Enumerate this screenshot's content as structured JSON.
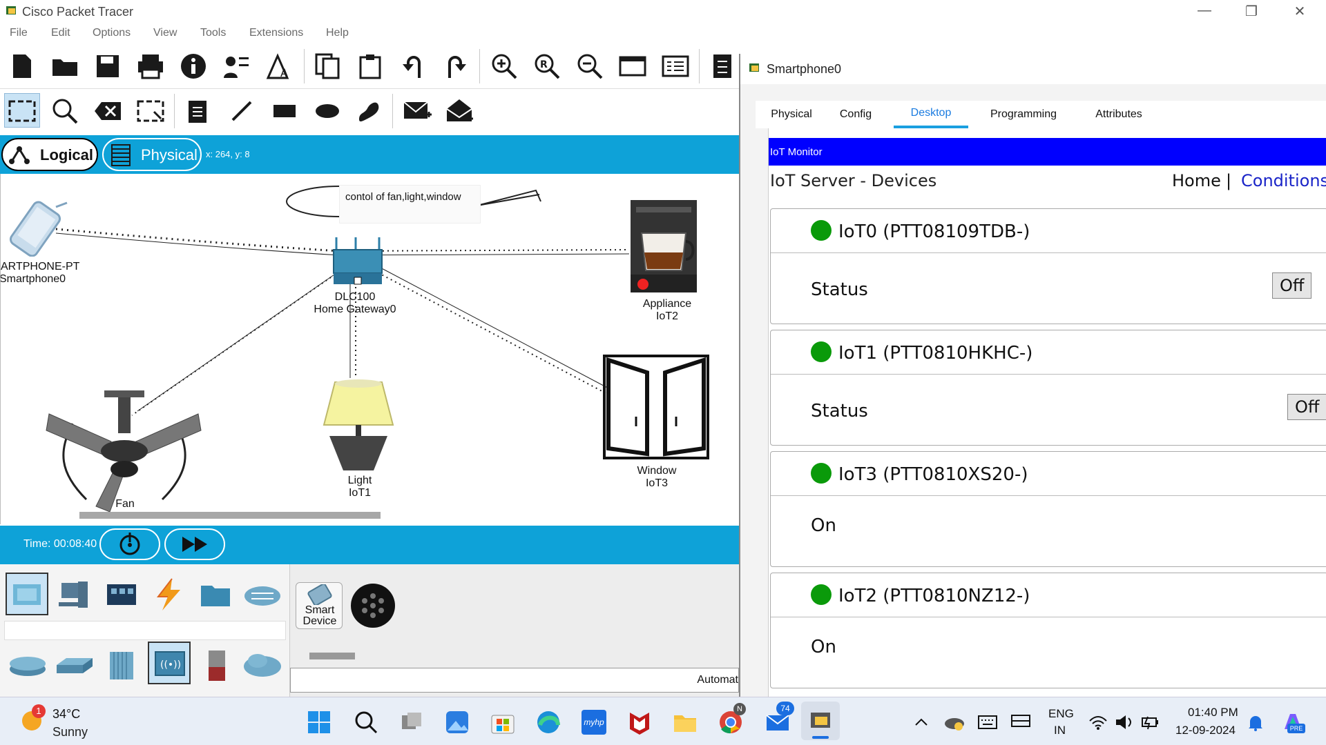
{
  "window": {
    "title": "Cisco Packet Tracer"
  },
  "menu": [
    "File",
    "Edit",
    "Options",
    "View",
    "Tools",
    "Extensions",
    "Help"
  ],
  "logical_bar": {
    "logical": "Logical",
    "physical": "Physical",
    "coords": "x: 264, y: 8"
  },
  "workspace": {
    "note": "contol of fan,light,window",
    "smartphone": {
      "model": "ARTPHONE-PT",
      "name": "Smartphone0"
    },
    "gateway": {
      "model": "DLC100",
      "name": "Home Gateway0"
    },
    "appliance": {
      "model": "Appliance",
      "name": "IoT2"
    },
    "window_dev": {
      "model": "Window",
      "name": "IoT3"
    },
    "light": {
      "model": "Light",
      "name": "IoT1"
    },
    "fan": {
      "model": "Fan"
    }
  },
  "timebar": {
    "time": "Time: 00:08:40"
  },
  "palette": {
    "smart_device": [
      "Smart",
      "Device"
    ],
    "auto_text": "Automat"
  },
  "smartphone_window": {
    "title": "Smartphone0",
    "tabs": [
      "Physical",
      "Config",
      "Desktop",
      "Programming",
      "Attributes"
    ],
    "active_tab": "Desktop",
    "iot_monitor": "IoT Monitor",
    "server_title": "IoT Server - Devices",
    "nav_home": "Home",
    "nav_sep": "|",
    "nav_conditions": "Conditions",
    "devices": [
      {
        "name": "IoT0 (PTT08109TDB-)",
        "label": "Status",
        "button": "Off"
      },
      {
        "name": "IoT1 (PTT0810HKHC-)",
        "label": "Status",
        "button": "Off"
      },
      {
        "name": "IoT3 (PTT0810XS20-)",
        "label": "On"
      },
      {
        "name": "IoT2 (PTT0810NZ12-)",
        "label": "On"
      }
    ]
  },
  "taskbar": {
    "weather_temp": "34°C",
    "weather_cond": "Sunny",
    "weather_badge": "1",
    "chrome_badge": "N",
    "mail_badge": "74",
    "myhp": "myhp",
    "lang_line1": "ENG",
    "lang_line2": "IN",
    "time": "01:40 PM",
    "date": "12-09-2024",
    "copilot_badge": "PRE"
  },
  "colors": {
    "accent_blue": "#0ea2d8",
    "iot_header": "#0000ff",
    "status_green": "#0a9a0a",
    "link_blue": "#1a24c8"
  }
}
